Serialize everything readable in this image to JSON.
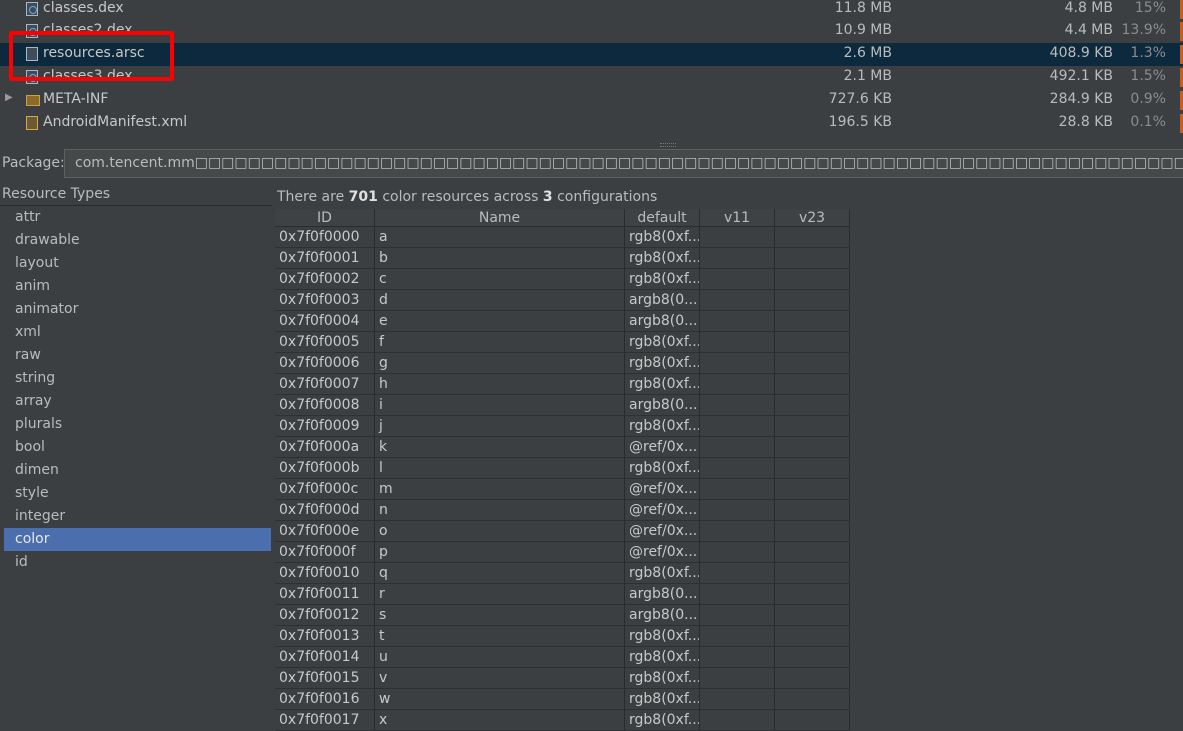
{
  "files": [
    {
      "name": "classes.dex",
      "raw": "11.8 MB",
      "compressed": "4.8 MB",
      "percent": "15%",
      "icon": "dex-file-icon",
      "expandable": false,
      "selected": false
    },
    {
      "name": "classes2.dex",
      "raw": "10.9 MB",
      "compressed": "4.4 MB",
      "percent": "13.9%",
      "icon": "dex-file-icon",
      "expandable": false,
      "selected": false
    },
    {
      "name": "resources.arsc",
      "raw": "2.6 MB",
      "compressed": "408.9 KB",
      "percent": "1.3%",
      "icon": "file-icon",
      "expandable": false,
      "selected": true
    },
    {
      "name": "classes3.dex",
      "raw": "2.1 MB",
      "compressed": "492.1 KB",
      "percent": "1.5%",
      "icon": "dex-file-icon",
      "expandable": false,
      "selected": false
    },
    {
      "name": "META-INF",
      "raw": "727.6 KB",
      "compressed": "284.9 KB",
      "percent": "0.9%",
      "icon": "folder-icon",
      "expandable": true,
      "selected": false
    },
    {
      "name": "AndroidManifest.xml",
      "raw": "196.5 KB",
      "compressed": "28.8 KB",
      "percent": "0.1%",
      "icon": "manifest-icon",
      "expandable": false,
      "selected": false
    }
  ],
  "package": {
    "label": "Package:",
    "value": "com.tencent.mm□□□□□□□□□□□□□□□□□□□□□□□□□□□□□□□□□□□□□□□□□□□□□□□□□□□□□□□□□□□□□□□□□□□□□□□□□□□□□□□□□□□□□□□□□□□□□□□□□□"
  },
  "resource_types": {
    "header": "Resource Types",
    "items": [
      "attr",
      "drawable",
      "layout",
      "anim",
      "animator",
      "xml",
      "raw",
      "string",
      "array",
      "plurals",
      "bool",
      "dimen",
      "style",
      "integer",
      "color",
      "id"
    ],
    "selected": "color"
  },
  "summary": {
    "prefix": "There are",
    "count": "701",
    "middle": "color resources across",
    "configs": "3",
    "suffix": "configurations"
  },
  "table": {
    "columns": [
      "ID",
      "Name",
      "default",
      "v11",
      "v23"
    ],
    "rows": [
      [
        "0x7f0f0000",
        "a",
        "rgb8(0xf...",
        "",
        ""
      ],
      [
        "0x7f0f0001",
        "b",
        "rgb8(0xf...",
        "",
        ""
      ],
      [
        "0x7f0f0002",
        "c",
        "rgb8(0xf...",
        "",
        ""
      ],
      [
        "0x7f0f0003",
        "d",
        "argb8(0...",
        "",
        ""
      ],
      [
        "0x7f0f0004",
        "e",
        "argb8(0...",
        "",
        ""
      ],
      [
        "0x7f0f0005",
        "f",
        "rgb8(0xf...",
        "",
        ""
      ],
      [
        "0x7f0f0006",
        "g",
        "rgb8(0xf...",
        "",
        ""
      ],
      [
        "0x7f0f0007",
        "h",
        "rgb8(0xf...",
        "",
        ""
      ],
      [
        "0x7f0f0008",
        "i",
        "argb8(0...",
        "",
        ""
      ],
      [
        "0x7f0f0009",
        "j",
        "rgb8(0xf...",
        "",
        ""
      ],
      [
        "0x7f0f000a",
        "k",
        "@ref/0x...",
        "",
        ""
      ],
      [
        "0x7f0f000b",
        "l",
        "rgb8(0xf...",
        "",
        ""
      ],
      [
        "0x7f0f000c",
        "m",
        "@ref/0x...",
        "",
        ""
      ],
      [
        "0x7f0f000d",
        "n",
        "@ref/0x...",
        "",
        ""
      ],
      [
        "0x7f0f000e",
        "o",
        "@ref/0x...",
        "",
        ""
      ],
      [
        "0x7f0f000f",
        "p",
        "@ref/0x...",
        "",
        ""
      ],
      [
        "0x7f0f0010",
        "q",
        "rgb8(0xf...",
        "",
        ""
      ],
      [
        "0x7f0f0011",
        "r",
        "argb8(0...",
        "",
        ""
      ],
      [
        "0x7f0f0012",
        "s",
        "argb8(0...",
        "",
        ""
      ],
      [
        "0x7f0f0013",
        "t",
        "rgb8(0xf...",
        "",
        ""
      ],
      [
        "0x7f0f0014",
        "u",
        "rgb8(0xf...",
        "",
        ""
      ],
      [
        "0x7f0f0015",
        "v",
        "rgb8(0xf...",
        "",
        ""
      ],
      [
        "0x7f0f0016",
        "w",
        "rgb8(0xf...",
        "",
        ""
      ],
      [
        "0x7f0f0017",
        "x",
        "rgb8(0xf...",
        "",
        ""
      ]
    ]
  },
  "colors": {
    "background": "#3c3f41",
    "selection": "#0d293e",
    "list_selection": "#4b6eaf",
    "size_bar": "#c75d1f",
    "annotation": "#ff0000"
  }
}
